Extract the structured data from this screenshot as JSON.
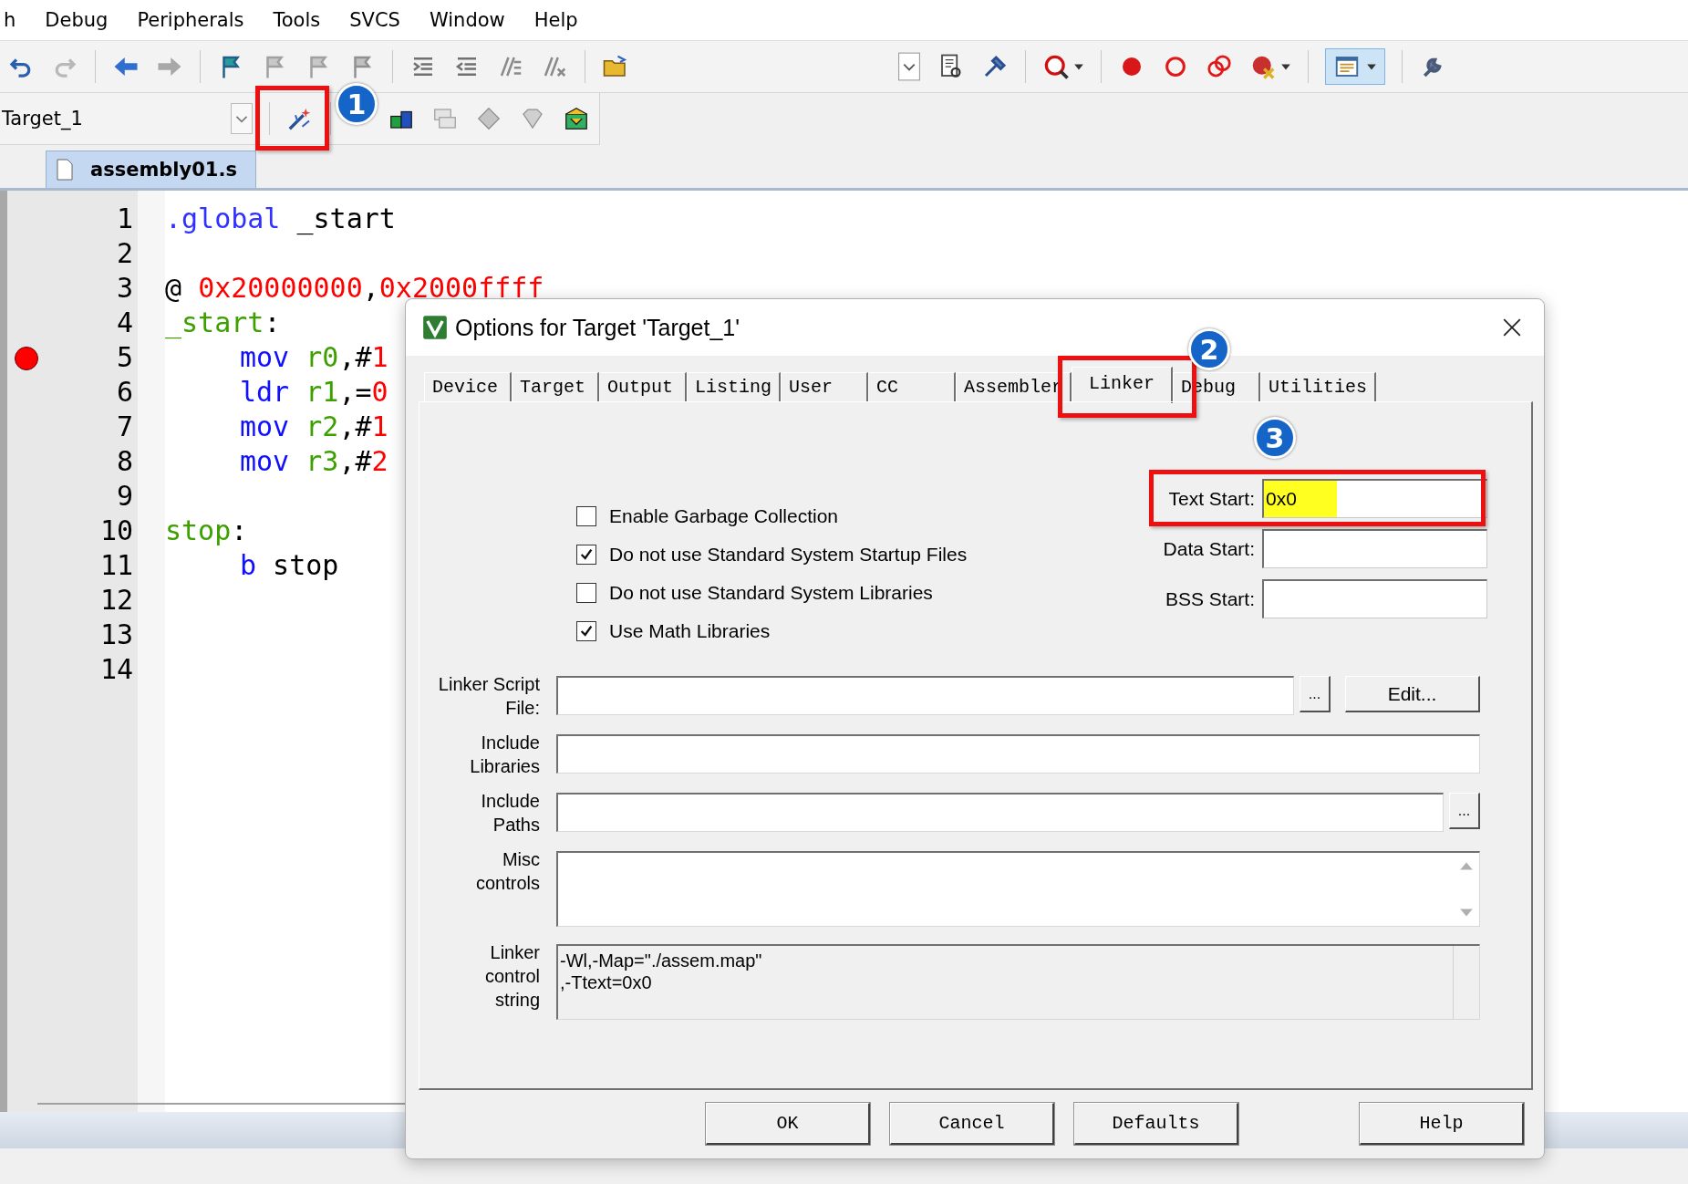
{
  "menu": [
    {
      "label": "h"
    },
    {
      "label": "Debug"
    },
    {
      "label": "Peripherals"
    },
    {
      "label": "Tools"
    },
    {
      "label": "SVCS"
    },
    {
      "label": "Window"
    },
    {
      "label": "Help"
    }
  ],
  "target_select": {
    "value": "Target_1"
  },
  "file_tabs": [
    {
      "label": "assembly01.s",
      "selected": true
    }
  ],
  "editor": {
    "lines": [
      {
        "number": "1",
        "breakpoint": false,
        "tokens": [
          {
            "kind": "directive",
            "text": ".global"
          },
          {
            "kind": "plain",
            "text": " _start"
          }
        ]
      },
      {
        "number": "2",
        "breakpoint": false
      },
      {
        "number": "3",
        "breakpoint": false,
        "tokens": [
          {
            "kind": "plain",
            "text": "@ "
          },
          {
            "kind": "number",
            "text": "0x20000000"
          },
          {
            "kind": "plain",
            "text": ","
          },
          {
            "kind": "number",
            "text": "0x2000ffff"
          }
        ]
      },
      {
        "number": "4",
        "breakpoint": false,
        "tokens": [
          {
            "kind": "label",
            "text": "_start"
          },
          {
            "kind": "plain",
            "text": ":"
          }
        ]
      },
      {
        "number": "5",
        "breakpoint": true,
        "indented": true,
        "tokens": [
          {
            "kind": "keyword",
            "text": "mov"
          },
          {
            "kind": "register",
            "text": " r0"
          },
          {
            "kind": "plain",
            "text": ",#"
          },
          {
            "kind": "number",
            "text": "1"
          }
        ]
      },
      {
        "number": "6",
        "breakpoint": false,
        "indented": true,
        "tokens": [
          {
            "kind": "keyword",
            "text": "ldr"
          },
          {
            "kind": "register",
            "text": " r1"
          },
          {
            "kind": "plain",
            "text": ",="
          },
          {
            "kind": "number",
            "text": "0"
          }
        ]
      },
      {
        "number": "7",
        "breakpoint": false,
        "indented": true,
        "tokens": [
          {
            "kind": "keyword",
            "text": "mov"
          },
          {
            "kind": "register",
            "text": " r2"
          },
          {
            "kind": "plain",
            "text": ",#"
          },
          {
            "kind": "number",
            "text": "1"
          }
        ]
      },
      {
        "number": "8",
        "breakpoint": false,
        "indented": true,
        "tokens": [
          {
            "kind": "keyword",
            "text": "mov"
          },
          {
            "kind": "register",
            "text": " r3"
          },
          {
            "kind": "plain",
            "text": ",#"
          },
          {
            "kind": "number",
            "text": "2"
          }
        ]
      },
      {
        "number": "9",
        "breakpoint": false
      },
      {
        "number": "10",
        "breakpoint": false,
        "tokens": [
          {
            "kind": "label",
            "text": "stop"
          },
          {
            "kind": "plain",
            "text": ":"
          }
        ]
      },
      {
        "number": "11",
        "breakpoint": false,
        "indented": true,
        "tokens": [
          {
            "kind": "keyword",
            "text": "b"
          },
          {
            "kind": "plain",
            "text": " stop"
          }
        ]
      },
      {
        "number": "12",
        "breakpoint": false
      },
      {
        "number": "13",
        "breakpoint": false
      },
      {
        "number": "14",
        "breakpoint": false
      }
    ]
  },
  "dialog": {
    "title": "Options for Target 'Target_1'",
    "tabs": [
      {
        "label": "Device",
        "selected": false
      },
      {
        "label": "Target",
        "selected": false
      },
      {
        "label": "Output",
        "selected": false
      },
      {
        "label": "Listing",
        "selected": false
      },
      {
        "label": "User",
        "selected": false
      },
      {
        "label": "CC",
        "selected": false
      },
      {
        "label": "Assembler",
        "selected": false
      },
      {
        "label": "Linker",
        "selected": true
      },
      {
        "label": "Debug",
        "selected": false
      },
      {
        "label": "Utilities",
        "selected": false
      }
    ],
    "checkboxes": [
      {
        "label": "Enable Garbage Collection",
        "checked": false
      },
      {
        "label": "Do not use Standard System Startup Files",
        "checked": true
      },
      {
        "label": "Do not use Standard System Libraries",
        "checked": false
      },
      {
        "label": "Use Math Libraries",
        "checked": true
      }
    ],
    "address_fields": [
      {
        "label": "Text Start:",
        "value": "0x0",
        "highlighted": true
      },
      {
        "label": "Data Start:",
        "highlighted": false
      },
      {
        "label": "BSS Start:",
        "highlighted": false
      }
    ],
    "fields": [
      {
        "kind": "file",
        "label": "Linker Script\nFile:",
        "browse": "...",
        "edit": "Edit..."
      },
      {
        "kind": "plain",
        "label": "Include\nLibraries"
      },
      {
        "kind": "path",
        "label": "Include\nPaths",
        "browse": "..."
      },
      {
        "kind": "multiline",
        "label": "Misc\ncontrols"
      },
      {
        "kind": "readonly",
        "label": "Linker\ncontrol\nstring",
        "lines": [
          "-Wl,-Map=\"./assem.map\"",
          ",-Ttext=0x0"
        ]
      }
    ],
    "buttons": [
      {
        "label": "OK"
      },
      {
        "label": "Cancel"
      },
      {
        "label": "Defaults"
      },
      {
        "label": "Help"
      }
    ]
  },
  "annotations": [
    {
      "number": "1"
    },
    {
      "number": "2"
    },
    {
      "number": "3"
    }
  ]
}
